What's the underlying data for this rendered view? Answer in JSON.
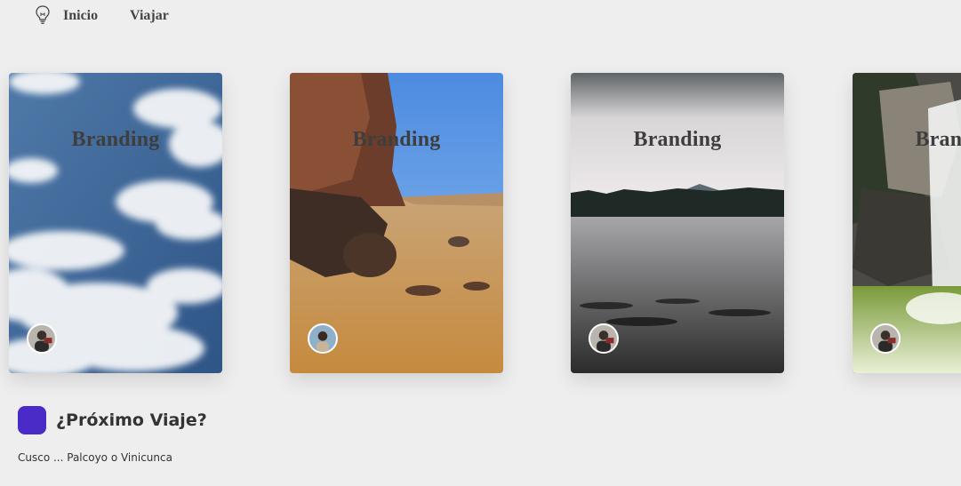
{
  "nav": {
    "icon": "lightbulb-icon",
    "items": [
      {
        "label": "Inicio"
      },
      {
        "label": "Viajar"
      }
    ]
  },
  "cards": [
    {
      "title": "Branding",
      "scene": "sky with clouds"
    },
    {
      "title": "Branding",
      "scene": "rocky beach"
    },
    {
      "title": "Branding",
      "scene": "lake at dusk"
    },
    {
      "title": "Branding",
      "scene": "waterfall"
    }
  ],
  "next_trip": {
    "title": "¿Próximo Viaje?",
    "description": "Cusco ... Palcoyo o Vinicunca",
    "accent": "#4b2bc8"
  }
}
